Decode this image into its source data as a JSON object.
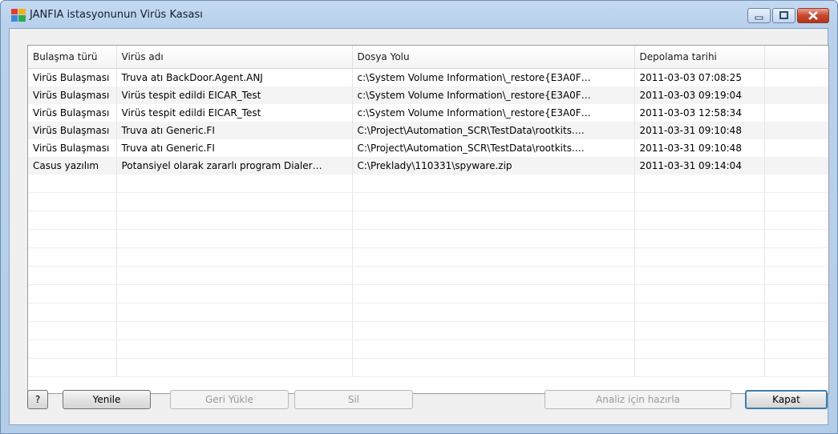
{
  "window": {
    "title": "JANFIA istasyonunun Virüs Kasası"
  },
  "table": {
    "columns": [
      "Bulaşma türü",
      "Virüs adı",
      "Dosya Yolu",
      "Depolama tarihi",
      ""
    ],
    "rows": [
      [
        "Virüs Bulaşması",
        "Truva atı BackDoor.Agent.ANJ",
        "c:\\System Volume Information\\_restore{E3A0F…",
        "2011-03-03 07:08:25"
      ],
      [
        "Virüs Bulaşması",
        "Virüs tespit edildi EICAR_Test",
        "c:\\System Volume Information\\_restore{E3A0F…",
        "2011-03-03 09:19:04"
      ],
      [
        "Virüs Bulaşması",
        "Virüs tespit edildi EICAR_Test",
        "c:\\System Volume Information\\_restore{E3A0F…",
        "2011-03-03 12:58:34"
      ],
      [
        "Virüs Bulaşması",
        "Truva atı Generic.FI",
        "C:\\Project\\Automation_SCR\\TestData\\rootkits.…",
        "2011-03-31 09:10:48"
      ],
      [
        "Virüs Bulaşması",
        "Truva atı Generic.FI",
        "C:\\Project\\Automation_SCR\\TestData\\rootkits.…",
        "2011-03-31 09:10:48"
      ],
      [
        "Casus yazılım",
        "Potansiyel olarak zararlı program Dialer…",
        "C:\\Preklady\\110331\\spyware.zip",
        "2011-03-31 09:14:04"
      ]
    ]
  },
  "buttons": {
    "help": "?",
    "refresh": "Yenile",
    "restore": "Geri Yükle",
    "delete": "Sil",
    "prepare_analysis": "Analiz için hazırla",
    "close": "Kapat"
  }
}
